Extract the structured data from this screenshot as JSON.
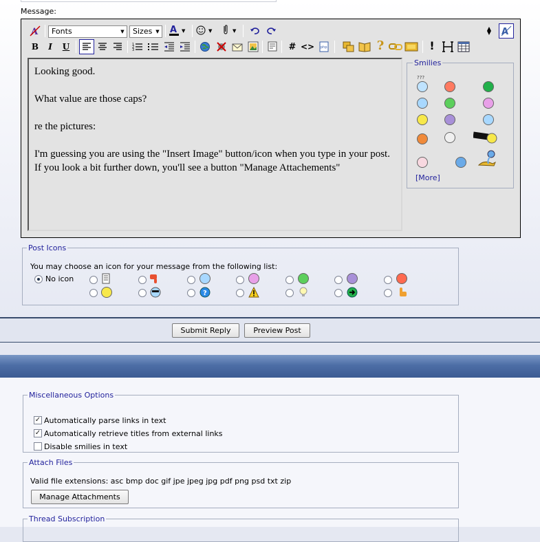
{
  "message_label": "Message:",
  "toolbar": {
    "fonts": "Fonts",
    "sizes": "Sizes",
    "bold": "B",
    "italic": "I",
    "underline": "U",
    "hash": "#",
    "code": "<>",
    "font_color_glyph": "A",
    "colors": {
      "accent": "#22229c",
      "red": "#cc0000"
    }
  },
  "message_text": [
    "Looking good.",
    "What value are those caps?",
    "re the pictures:",
    "I'm guessing you are using the \"Insert Image\" button/icon when you type in your post. If you look a bit further down, you'll see a button \"Manage Attachements\""
  ],
  "smilies": {
    "legend": "Smilies",
    "more": "[More]",
    "icons": [
      "confused",
      "mad",
      "alien",
      "smile",
      "grin",
      "cool",
      "happy",
      "sad",
      "wink",
      "evil",
      "eek",
      "camera",
      "smitten",
      "roll",
      "genie"
    ]
  },
  "post_icons": {
    "legend": "Post Icons",
    "instruction": "You may choose an icon for your message from the following list:",
    "no_icon": "No icon",
    "icons": [
      "document",
      "thumbs-down",
      "wink",
      "tongue",
      "grin",
      "sad",
      "angry",
      "smile",
      "cool",
      "question",
      "warning",
      "lightbulb",
      "arrow-right",
      "thumbs-up"
    ]
  },
  "buttons": {
    "submit": "Submit Reply",
    "preview": "Preview Post"
  },
  "misc": {
    "legend": "Miscellaneous Options",
    "parse_links": "Automatically parse links in text",
    "retrieve_titles": "Automatically retrieve titles from external links",
    "disable_smilies": "Disable smilies in text"
  },
  "attach": {
    "legend": "Attach Files",
    "extensions": "Valid file extensions: asc bmp doc gif jpe jpeg jpg pdf png psd txt zip",
    "manage": "Manage Attachments"
  },
  "thread_sub": {
    "legend": "Thread Subscription"
  }
}
